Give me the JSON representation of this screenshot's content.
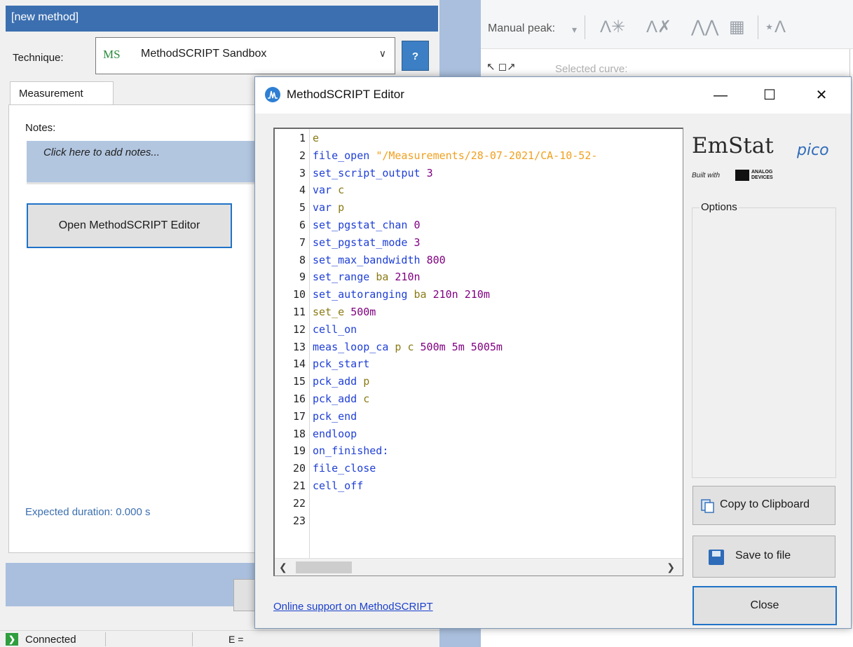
{
  "method_panel": {
    "header_title": "[new method]",
    "technique_label": "Technique:",
    "technique_badge": "MS",
    "technique_value": "MethodSCRIPT Sandbox",
    "help_label": "?",
    "tab_label": "Measurement",
    "notes_label": "Notes:",
    "notes_placeholder": "Click here to add notes...",
    "open_editor_label": "Open MethodSCRIPT Editor",
    "expected_duration": "Expected duration: 0.000 s"
  },
  "status_bar": {
    "connection": "Connected",
    "potential": "E = "
  },
  "peak_toolbar": {
    "manual_peak_label": "Manual peak:",
    "selected_curve_label": "Selected curve:"
  },
  "editor": {
    "title": "MethodSCRIPT Editor",
    "minimize": "—",
    "maximize": "☐",
    "close_x": "✕",
    "logo_main": "EmStat",
    "logo_sub": "pico",
    "logo_built_with": "Built with",
    "logo_adi": "ANALOG DEVICES",
    "options_label": "Options",
    "copy_label": "Copy to Clipboard",
    "save_label": "Save to file",
    "close_label": "Close",
    "support_link": "Online support on MethodSCRIPT",
    "lines": [
      {
        "n": "1",
        "tokens": [
          [
            "e",
            "var"
          ]
        ]
      },
      {
        "n": "2",
        "tokens": [
          [
            "file_open ",
            "kw"
          ],
          [
            "\"/Measurements/28-07-2021/CA-10-52-",
            "str"
          ]
        ]
      },
      {
        "n": "3",
        "tokens": [
          [
            "set_script_output ",
            "kw"
          ],
          [
            "3",
            "num"
          ]
        ]
      },
      {
        "n": "4",
        "tokens": [
          [
            "var ",
            "kw"
          ],
          [
            "c",
            "var"
          ]
        ]
      },
      {
        "n": "5",
        "tokens": [
          [
            "var ",
            "kw"
          ],
          [
            "p",
            "var"
          ]
        ]
      },
      {
        "n": "6",
        "tokens": [
          [
            "set_pgstat_chan ",
            "kw"
          ],
          [
            "0",
            "num"
          ]
        ]
      },
      {
        "n": "7",
        "tokens": [
          [
            "set_pgstat_mode ",
            "kw"
          ],
          [
            "3",
            "num"
          ]
        ]
      },
      {
        "n": "8",
        "tokens": [
          [
            "set_max_bandwidth ",
            "kw"
          ],
          [
            "800",
            "num"
          ]
        ]
      },
      {
        "n": "9",
        "tokens": [
          [
            "set_range ",
            "kw"
          ],
          [
            "ba ",
            "var"
          ],
          [
            "210n",
            "num"
          ]
        ]
      },
      {
        "n": "10",
        "tokens": [
          [
            "set_autoranging ",
            "kw"
          ],
          [
            "ba ",
            "var"
          ],
          [
            "210n 210m",
            "num"
          ]
        ]
      },
      {
        "n": "11",
        "tokens": [
          [
            "set_e ",
            "var"
          ],
          [
            "500m",
            "num"
          ]
        ]
      },
      {
        "n": "12",
        "tokens": [
          [
            "cell_on",
            "kw"
          ]
        ]
      },
      {
        "n": "13",
        "tokens": [
          [
            "meas_loop_ca ",
            "kw"
          ],
          [
            "p c ",
            "var"
          ],
          [
            "500m 5m 5005m",
            "num"
          ]
        ]
      },
      {
        "n": "14",
        "tokens": [
          [
            "pck_start",
            "kw"
          ]
        ]
      },
      {
        "n": "15",
        "tokens": [
          [
            "pck_add ",
            "kw"
          ],
          [
            "p",
            "var"
          ]
        ]
      },
      {
        "n": "16",
        "tokens": [
          [
            "pck_add ",
            "kw"
          ],
          [
            "c",
            "var"
          ]
        ]
      },
      {
        "n": "17",
        "tokens": [
          [
            "pck_end",
            "kw"
          ]
        ]
      },
      {
        "n": "18",
        "tokens": [
          [
            "endloop",
            "kw"
          ]
        ]
      },
      {
        "n": "19",
        "tokens": [
          [
            "on_finished:",
            "kw"
          ]
        ]
      },
      {
        "n": "20",
        "tokens": [
          [
            "file_close",
            "kw"
          ]
        ]
      },
      {
        "n": "21",
        "tokens": [
          [
            "cell_off",
            "kw"
          ]
        ]
      },
      {
        "n": "22",
        "tokens": []
      },
      {
        "n": "23",
        "tokens": []
      }
    ]
  },
  "colors": {
    "header_blue": "#3c6fb0",
    "keyword": "#1f3fd6",
    "variable": "#8a7a14",
    "number": "#800080",
    "string": "#f0a020",
    "link": "#1a3fcc"
  }
}
